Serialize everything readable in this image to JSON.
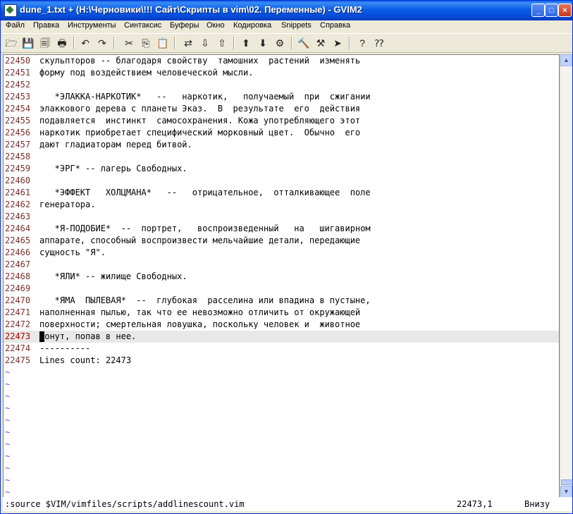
{
  "window": {
    "title": "dune_1.txt + (H:\\Черновики\\!!! Сайт\\Скрипты в vim\\02. Переменные) - GVIM2",
    "controls": [
      "_",
      "□",
      "×"
    ]
  },
  "menu": [
    "Файл",
    "Правка",
    "Инструменты",
    "Синтаксис",
    "Буферы",
    "Окно",
    "Кодировка",
    "Snippets",
    "Справка"
  ],
  "toolbar": {
    "icons": [
      "open-icon",
      "save-icon",
      "save-all-icon",
      "print-icon",
      "undo-icon",
      "redo-icon",
      "cut-icon",
      "copy-icon",
      "paste-icon",
      "replace-icon",
      "find-next-icon",
      "find-prev-icon",
      "load-session-icon",
      "save-session-icon",
      "run-script-icon",
      "make-icon",
      "run-ctags-icon",
      "tag-jump-icon",
      "help-icon",
      "find-help-icon"
    ],
    "glyphs": [
      "🗁",
      "💾",
      "🗐",
      "🖶",
      "↶",
      "↷",
      "✂",
      "⎘",
      "📋",
      "⇄",
      "⇩",
      "⇧",
      "⬆",
      "⬇",
      "⚙",
      "🔨",
      "⚒",
      "➤",
      "?",
      "⁇"
    ]
  },
  "editor": {
    "lines": [
      {
        "num": "22450",
        "text": "скульпторов -- благодаря свойству  тамошних  растений  изменять"
      },
      {
        "num": "22451",
        "text": "форму под воздействием человеческой мысли."
      },
      {
        "num": "22452",
        "text": ""
      },
      {
        "num": "22453",
        "text": "   *ЭЛАККА-НАРКОТИК*   --   наркотик,   получаемый  при  сжигании"
      },
      {
        "num": "22454",
        "text": "элаккового дерева с планеты Эказ.  В  результате  его  действия"
      },
      {
        "num": "22455",
        "text": "подавляется  инстинкт  самосохранения. Кожа употребляющего этот"
      },
      {
        "num": "22456",
        "text": "наркотик приобретает специфический морковный цвет.  Обычно  его"
      },
      {
        "num": "22457",
        "text": "дают гладиаторам перед битвой."
      },
      {
        "num": "22458",
        "text": ""
      },
      {
        "num": "22459",
        "text": "   *ЭРГ* -- лагерь Свободных."
      },
      {
        "num": "22460",
        "text": ""
      },
      {
        "num": "22461",
        "text": "   *ЭФФЕКТ   ХОЛЦМАНА*   --   отрицательное,  отталкивающее  поле"
      },
      {
        "num": "22462",
        "text": "генератора."
      },
      {
        "num": "22463",
        "text": ""
      },
      {
        "num": "22464",
        "text": "   *Я-ПОДОБИЕ*  --  портрет,   воспроизведенный   на   шигавирном"
      },
      {
        "num": "22465",
        "text": "аппарате, способный воспроизвести мельчайшие детали, передающие"
      },
      {
        "num": "22466",
        "text": "сущность \"Я\"."
      },
      {
        "num": "22467",
        "text": ""
      },
      {
        "num": "22468",
        "text": "   *ЯЛИ* -- жилище Свободных."
      },
      {
        "num": "22469",
        "text": ""
      },
      {
        "num": "22470",
        "text": "   *ЯМА  ПЫЛЕВАЯ*  --  глубокая  расселина или впадина в пустыне,"
      },
      {
        "num": "22471",
        "text": "наполненная пылью, так что ее невозможно отличить от окружающей"
      },
      {
        "num": "22472",
        "text": "поверхности; смертельная ловушка, поскольку человек и  животное"
      },
      {
        "num": "22473",
        "text": "тонут, попав в нее.",
        "current": true
      },
      {
        "num": "22474",
        "text": "----------"
      },
      {
        "num": "22475",
        "text": "Lines count: 22473"
      }
    ],
    "tilde": "~",
    "tilde_count": 11
  },
  "scrollbar": {
    "up": "▲",
    "down": "▼"
  },
  "cmdline": {
    "command": ":source $VIM/vimfiles/scripts/addlinescount.vim",
    "position": "22473,1",
    "where": "Внизу"
  }
}
